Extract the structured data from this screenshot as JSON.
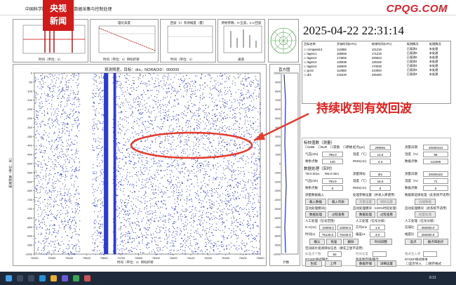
{
  "app": {
    "title": "中国科学院 — 风廓线雷达数据采集与控制处理",
    "logo_top": "央视",
    "logo_bottom": "新闻",
    "watermark": "CPQG.COM"
  },
  "datetime": "2025-04-22 22:31:14",
  "mini_charts": [
    {
      "title": "",
      "xlabel": "时间（单位：s）",
      "ylabel": "",
      "ticks": [
        "400",
        "800",
        "1200"
      ]
    },
    {
      "title": "理论高度",
      "xlabel": "时间（单位：s）目标折射",
      "ylabel": "",
      "ticks": [
        "75100",
        "75200",
        "75300"
      ]
    },
    {
      "title": "回波（I）有效幅度（量）",
      "xlabel": "时间（单位：s）",
      "ylabel": "",
      "ticks": [
        "75100",
        "75200",
        "75300"
      ]
    },
    {
      "title": "原始参数，0-全波，1-x-回波",
      "xlabel": "通道",
      "ylabel": "",
      "ticks": [
        "1",
        "2",
        "3",
        "4",
        "5"
      ]
    }
  ],
  "target_table": {
    "headers": [
      "目标名称",
      "开始时间(UTC)",
      "结束时间(UTC)",
      "观测情况",
      "处理情况"
    ],
    "rows": [
      [
        "compass13",
        "114858",
        "121218",
        "已观测4",
        "未处理"
      ],
      [
        "lagsrc1",
        "165556",
        "171218",
        "已观测6",
        "未处理"
      ],
      [
        "lagsrc2",
        "174652",
        "225543",
        "已观测6",
        "未处理"
      ],
      [
        "lagsrc3",
        "125838",
        "135158",
        "已观测4",
        "未处理"
      ],
      [
        "lagsrc4",
        "160500",
        "170038",
        "已观测4",
        "未处理"
      ],
      [
        "gcs3",
        "114858",
        "210000",
        "已观测4",
        "未处理"
      ],
      [
        "drs",
        "215220",
        "235400",
        "已观测4",
        "未处理"
      ]
    ]
  },
  "main_chart": {
    "title": "观测残差，目标：drs，NORADID：000000",
    "xlabel": "时间（单位：s）目标折射",
    "ylabel": "距离残差（单位：米）"
  },
  "histogram": {
    "title": "直方图",
    "xlabel": "计数"
  },
  "settings": {
    "sec1_title": "标校值数（测量）",
    "checks": [
      "USB",
      "SLR",
      "其他",
      "原始"
    ],
    "rows1": [
      {
        "l1": "起点(μs)",
        "v1": "299061",
        "l2": "测量日期",
        "v2": "20250413"
      },
      {
        "l1": "气压(mb)",
        "v1": "796.0",
        "l2": "温度（℃）",
        "v2": "12.5"
      },
      {
        "l1": "湿度（%）",
        "v2": "66",
        "l3": "剩余点数",
        "v3": "140",
        "l4": "RMS(cm)",
        "v4": "4.4",
        "l5": "数据点数",
        "v5": "112305"
      }
    ],
    "sec2_title": "数据处理（实时）",
    "rows2a": {
      "l1": "TB:0.00ns",
      "l2": "RB:0.00m",
      "l3": "测量目标",
      "v3": "drs",
      "l4": "测量日期",
      "v4": "20250422"
    },
    "rows2b": {
      "l1": "气压(mb)",
      "v1": "794.9",
      "l2": "温度（℃）",
      "v2": "16.0",
      "l3": "湿度（%）",
      "v3": "71"
    },
    "rows2c": {
      "l1": "剩余点数",
      "v1": "0",
      "l2": "RMS(cm)",
      "v2": "0",
      "l3": "数据点数",
      "v3": "0"
    },
    "groups": [
      {
        "title": "测量数据载入",
        "buttons": [
          "载入数据",
          "载入列表"
        ]
      },
      {
        "title": "处理参数设置（并发入库使用）",
        "buttons": [
          "流量设置",
          "剔除设置"
        ]
      },
      {
        "title": "数据库选择处理（此系统不适用）",
        "buttons": [
          "远端数据"
        ]
      }
    ],
    "groups2": [
      {
        "title": "自动处理模块()",
        "buttons": [
          "数据处理",
          "过程查看"
        ]
      },
      {
        "title": "自动处理模块（100%时延处理）",
        "buttons": [
          "数据处理",
          "过程查看"
        ]
      },
      {
        "title": "自动处理模块（此系统不适用）",
        "buttons": [
          "批量处理"
        ]
      }
    ],
    "manual": {
      "title1": "人工处理（信号范围）",
      "title2": "人工处理（信号分级）",
      "title3": "人工处理（信号分级）",
      "l1": "D-C(ns)",
      "v1a": "-10000.0",
      "v1b": "10000.0",
      "l2": "时间(s)",
      "v2a": "75140.0",
      "v2b": "76449.0",
      "l3": "方均sns",
      "v3": "1.0",
      "l4": "偏差ns",
      "v4": "3.0",
      "l5": "信噪比",
      "v5": "250000.0",
      "l6": "幅度比",
      "v6": "250000.0",
      "buttons": [
        "确认",
        "恢复",
        "删除"
      ],
      "buttons2": [
        "时间调整",
        "选点",
        "删点和剔点"
      ]
    },
    "export_title": "空间碎片观测目标信息（要先卫星不适用）",
    "export": {
      "l1": "标准点个数",
      "v1": "60",
      "l2": "时间长度",
      "v2": "",
      "l3": "格式化入率",
      "v3": ""
    },
    "bottom": {
      "g1": "RTSDF格式输出",
      "b1": [
        "生成",
        "上传"
      ],
      "g2": "残差图存储/输出",
      "b2": [
        "数据存储",
        "详细设置"
      ],
      "g3": "RTSDF格式样本",
      "c3": [
        "是否导入",
        "保存格式"
      ]
    }
  },
  "callout": "持续收到有效回波",
  "taskbar": {
    "time": "8:31"
  },
  "colors": {
    "points": "#1a2bd0",
    "accent_red": "#e8201e",
    "ellipse": "#e53a2e",
    "histogram_fill": "#2233cc"
  },
  "chart_data": [
    {
      "type": "scatter",
      "title": "观测残差，目标：drs，NORADID：000000",
      "xlabel": "时间（单位：s）目标折射",
      "ylabel": "距离残差（单位：米）",
      "xlim": [
        75200,
        76500
      ],
      "ylim": [
        -1000,
        0
      ],
      "x_ticks": [
        "75200",
        "75300",
        "75400",
        "75500",
        "75600",
        "75700",
        "75800",
        "75900",
        "76000",
        "76100",
        "76200",
        "76300",
        "76400",
        "76500"
      ],
      "y_ticks": [
        "0",
        "-50",
        "-100",
        "-150",
        "-200",
        "-250",
        "-300",
        "-350",
        "-400",
        "-450",
        "-500",
        "-550",
        "-600",
        "-650",
        "-700",
        "-750",
        "-800",
        "-850",
        "-900",
        "-950",
        "-1000"
      ],
      "point_density": "dense uniform noise",
      "gaps": [
        [
          75460,
          75530
        ],
        [
          75620,
          75650
        ]
      ],
      "dense_bands": [
        [
          75600,
          75625
        ],
        [
          75655,
          75670
        ]
      ],
      "annotation": "ellipse around -400 to -430, 75950-76250"
    },
    {
      "type": "bar",
      "title": "直方图",
      "xlabel": "计数",
      "y_ticks": [
        "10000",
        "9000",
        "8000",
        "7000",
        "6000",
        "5000",
        "4000",
        "3000",
        "2000",
        "1000",
        "0",
        "-1000",
        "-2000",
        "-3000",
        "-4000",
        "-5000",
        "-6000",
        "-7000",
        "-8000",
        "-9000",
        "-10000"
      ],
      "ylim": [
        -10000,
        10000
      ]
    }
  ]
}
